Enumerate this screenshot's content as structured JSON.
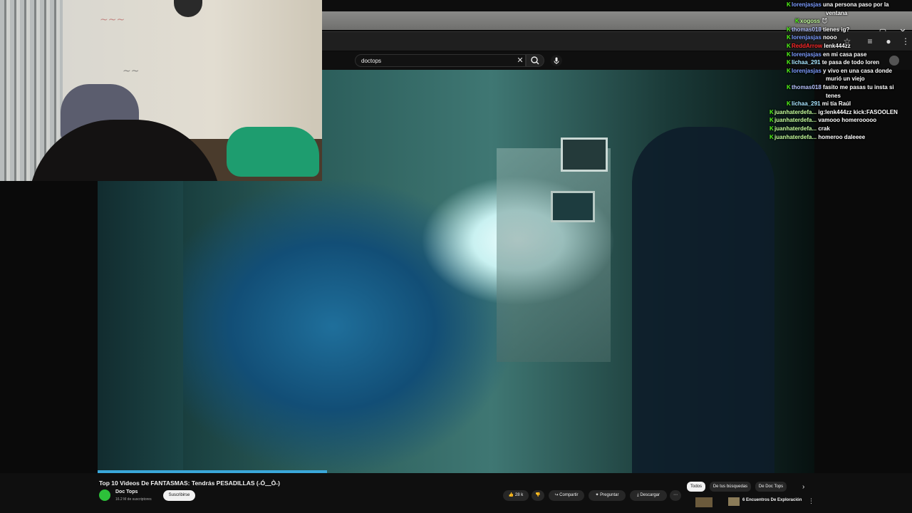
{
  "youtube": {
    "search_value": "doctops",
    "video_title": "Top 10 Videos De FANTASMAS: Tendrás PESADILLAS (˶Ó﹏Ò˶)",
    "channel_name": "Doc Tops",
    "subscribers": "16.2 M de suscriptores",
    "subscribe_label": "Suscribirse",
    "like_count": "28 k",
    "share_label": "Compartir",
    "ask_label": "Preguntar",
    "download_label": "Descargar",
    "more_label": "⋯",
    "chips": [
      "Todos",
      "De tus búsquedas",
      "De Doc Tops"
    ],
    "recommendation_title": "6 Encuentros De Exploración",
    "progress_fraction": 0.32
  },
  "chat": [
    {
      "user": "lorenjasjas",
      "msg": "una persona paso por la",
      "cls": "u-loren"
    },
    {
      "user": "",
      "msg": "ventana",
      "cls": ""
    },
    {
      "user": "xogoss",
      "msg": "😈",
      "cls": "u-xogoss"
    },
    {
      "user": "thomas018",
      "msg": "tienes ig?",
      "cls": "u-thomas"
    },
    {
      "user": "lorenjasjas",
      "msg": "nooo",
      "cls": "u-loren"
    },
    {
      "user": "ReddArrow",
      "msg": "lenk444zz",
      "cls": "u-red"
    },
    {
      "user": "lorenjasjas",
      "msg": "en mi casa pase",
      "cls": "u-loren"
    },
    {
      "user": "lichaa_291",
      "msg": "te pasa de todo loren",
      "cls": "u-lichaa"
    },
    {
      "user": "lorenjasjas",
      "msg": "y vivo en una casa donde",
      "cls": "u-loren"
    },
    {
      "user": "",
      "msg": "murió un viejo",
      "cls": ""
    },
    {
      "user": "thomas018",
      "msg": "fasito me pasas tu insta si",
      "cls": "u-thomas"
    },
    {
      "user": "",
      "msg": "tenes",
      "cls": ""
    },
    {
      "user": "lichaa_291",
      "msg": "mi tía Raúl",
      "cls": "u-lichaa"
    },
    {
      "user": "juanhaterdefa...",
      "msg": "ig:lenk444zz kick:FASOOLEN",
      "cls": "u-juan"
    },
    {
      "user": "juanhaterdefa...",
      "msg": "vamooo homerooooo",
      "cls": "u-juan"
    },
    {
      "user": "juanhaterdefa...",
      "msg": "crak",
      "cls": "u-juan"
    },
    {
      "user": "juanhaterdefa...",
      "msg": "homeroo daleeee",
      "cls": "u-juan"
    }
  ],
  "icons": {
    "search": "search-icon",
    "mic": "mic-icon",
    "close": "close-icon",
    "like": "thumbs-up-icon",
    "dislike": "thumbs-down-icon",
    "share": "share-icon",
    "ask": "sparkle-icon",
    "download": "download-icon",
    "chevron": "chevron-right-icon"
  },
  "colors": {
    "kick_green": "#53fc18",
    "youtube_bg": "#0f0f0f",
    "progress": "#3aa7d9"
  }
}
